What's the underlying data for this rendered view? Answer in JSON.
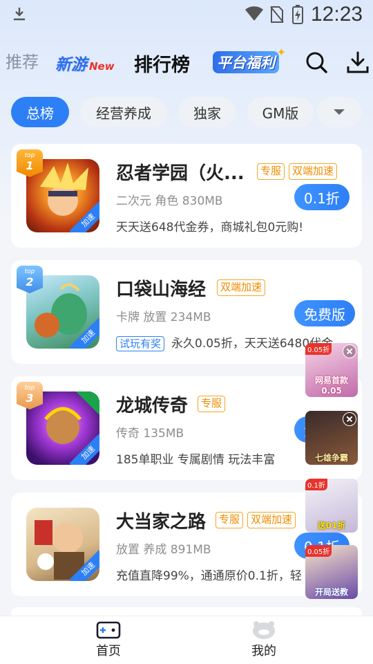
{
  "status_bar": {
    "time": "12:23"
  },
  "top_nav": {
    "tabs": [
      {
        "label": "推荐"
      },
      {
        "label": "新游",
        "badge": "New"
      },
      {
        "label": "排行榜"
      },
      {
        "label": "平台福利"
      }
    ]
  },
  "chips": [
    {
      "label": "总榜",
      "active": true
    },
    {
      "label": "经营养成"
    },
    {
      "label": "独家"
    },
    {
      "label": "GM版"
    }
  ],
  "games": [
    {
      "rank": "1",
      "rank_label": "top",
      "title": "忍者学园（火...",
      "tags": [
        "专服",
        "双端加速"
      ],
      "meta": "二次元 角色 830MB",
      "price": "0.1折",
      "desc": "天天送648代金券，商城礼包0元购!",
      "accel": "加速"
    },
    {
      "rank": "2",
      "rank_label": "top",
      "title": "口袋山海经",
      "tags": [
        "双端加速"
      ],
      "meta": "卡牌 放置 234MB",
      "price": "免费版",
      "trial": "试玩有奖",
      "desc": "永久0.05折，天天送6480代金",
      "accel": "加速"
    },
    {
      "rank": "3",
      "rank_label": "top",
      "title": "龙城传奇",
      "tags": [
        "专服"
      ],
      "meta": "传奇 135MB",
      "price": "免",
      "desc": "185单职业 专属剧情  玩法丰富",
      "accel": "加速"
    },
    {
      "rank": "",
      "title": "大当家之路",
      "tags": [
        "专服",
        "双端加速"
      ],
      "meta": "放置 养成 891MB",
      "price": "0.1折",
      "desc": "充值直降99%，通通原价0.1折，轻",
      "accel": "加速"
    }
  ],
  "float_ads": [
    {
      "badge": "0.05折",
      "caption": "网易首款0.05"
    },
    {
      "badge": "",
      "caption": "七雄争霸"
    },
    {
      "badge": "0.1折",
      "caption": "送01折"
    },
    {
      "badge": "0.05折",
      "caption": "开局送教"
    }
  ],
  "bottom_nav": {
    "home": "首页",
    "mine": "我的"
  }
}
